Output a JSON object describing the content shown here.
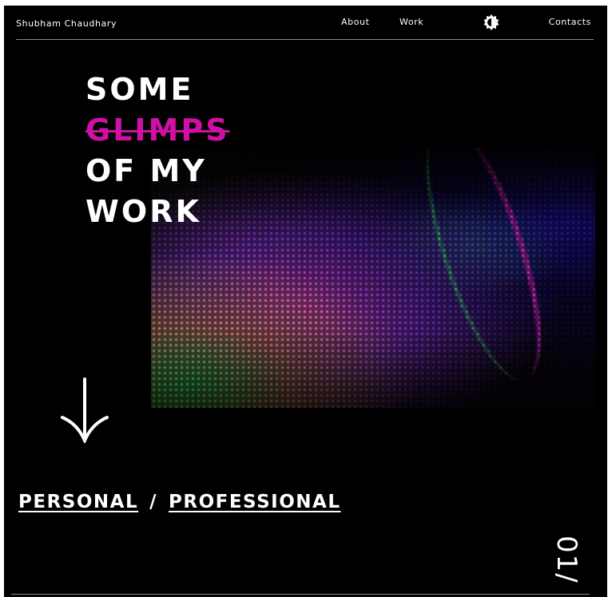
{
  "header": {
    "brand": "Shubham Chaudhary",
    "nav": [
      {
        "label": "About"
      },
      {
        "label": "Work"
      },
      {
        "label": "Contacts"
      }
    ],
    "theme_toggle_icon": "contrast-toggle-icon"
  },
  "hero": {
    "headline": {
      "line1": "SOME",
      "line2_struck": "GLIMPS",
      "line3": "OF MY",
      "line4": "WORK"
    },
    "accent_color": "#d10fa6",
    "scroll_icon": "arrow-down-icon"
  },
  "filters": {
    "personal": "PERSONAL",
    "separator": "/",
    "professional": "PROFESSIONAL"
  },
  "counter": "01/",
  "colors": {
    "background": "#000000",
    "text": "#ffffff"
  }
}
